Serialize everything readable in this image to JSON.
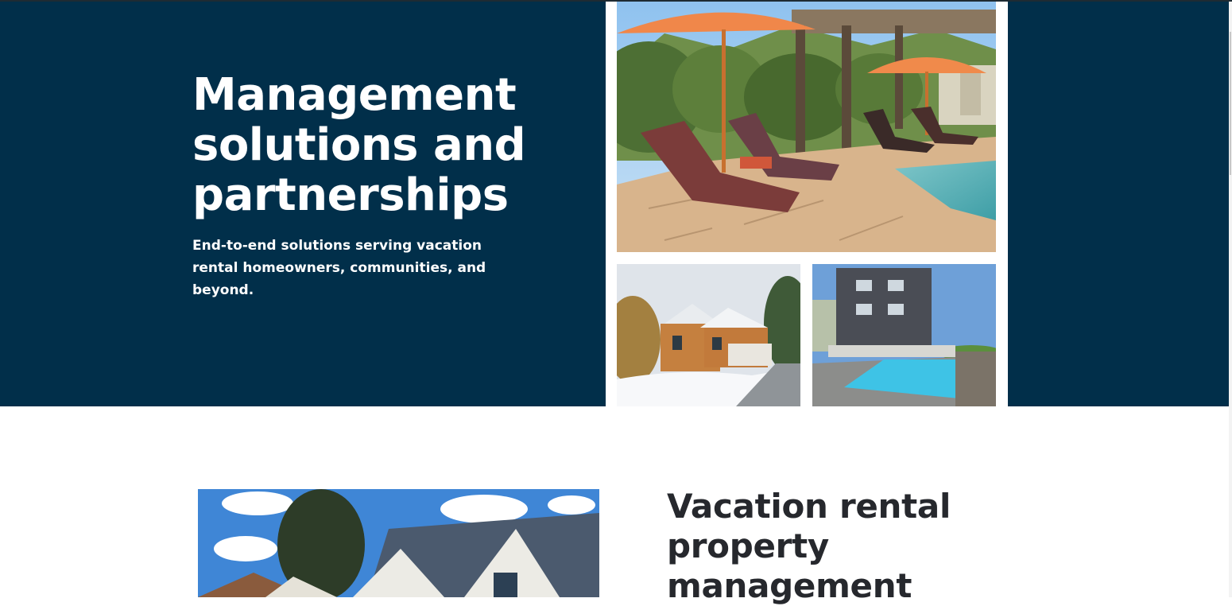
{
  "hero": {
    "title_lines": [
      "Management",
      "solutions and",
      "partnerships"
    ],
    "subtitle": "End-to-end solutions serving vacation rental homeowners, communities, and beyond."
  },
  "photos": {
    "large": "pool-patio-photo",
    "small_a": "snowy-house-photo",
    "small_b": "beach-house-pool-photo",
    "section": "house-roof-photo"
  },
  "section": {
    "title_lines": [
      "Vacation rental",
      "property",
      "management"
    ]
  },
  "colors": {
    "hero_bg": "#012f4a",
    "hero_text": "#ffffff",
    "section_title": "#26282d"
  }
}
